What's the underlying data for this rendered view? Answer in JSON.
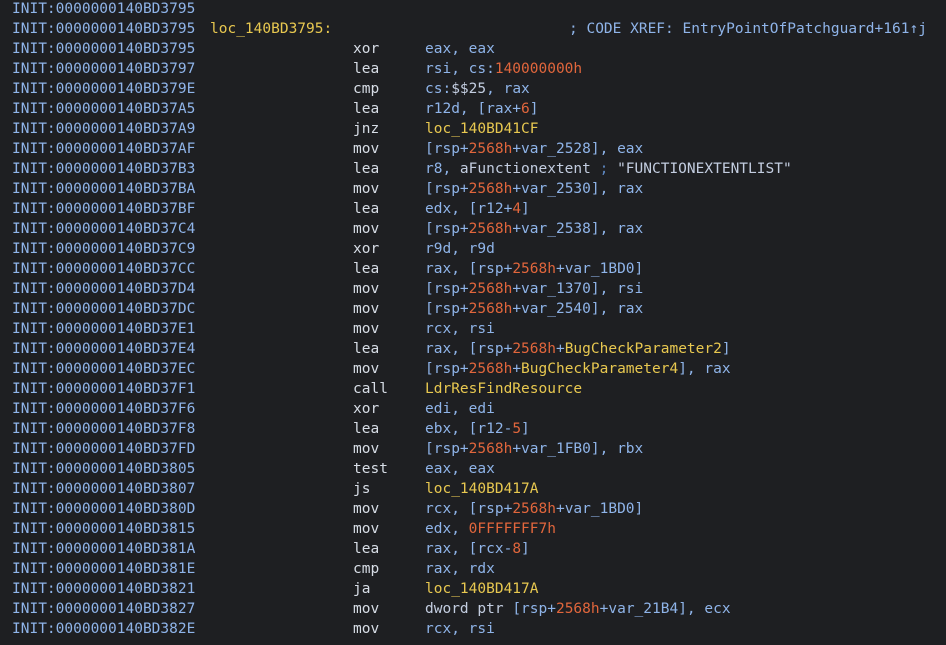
{
  "colors": {
    "background": "#1e1f22",
    "address": "#8fb4e9",
    "mnemonic": "#d7dde6",
    "register": "#8fb4e9",
    "number": "#e1663c",
    "symbol": "#e8c850",
    "string": "#c3cde0",
    "comment": "#5e88c2"
  },
  "listing": {
    "lines": [
      {
        "addr": "INIT:0000000140BD3795",
        "label": "",
        "mnemonic": "",
        "operands": [],
        "xref": ""
      },
      {
        "addr": "INIT:0000000140BD3795",
        "label": "loc_140BD3795:",
        "mnemonic": "",
        "operands": [],
        "xref": "; CODE XREF: EntryPointOfPatchguard+161↑j"
      },
      {
        "addr": "INIT:0000000140BD3795",
        "label": "",
        "mnemonic": "xor",
        "operands": [
          {
            "t": "reg",
            "v": "eax, eax"
          }
        ],
        "xref": ""
      },
      {
        "addr": "INIT:0000000140BD3797",
        "label": "",
        "mnemonic": "lea",
        "operands": [
          {
            "t": "reg",
            "v": "rsi, cs:"
          },
          {
            "t": "num",
            "v": "140000000h"
          }
        ],
        "xref": ""
      },
      {
        "addr": "INIT:0000000140BD379E",
        "label": "",
        "mnemonic": "cmp",
        "operands": [
          {
            "t": "reg",
            "v": "cs:"
          },
          {
            "t": "str",
            "v": "$$25"
          },
          {
            "t": "reg",
            "v": ", rax"
          }
        ],
        "xref": ""
      },
      {
        "addr": "INIT:0000000140BD37A5",
        "label": "",
        "mnemonic": "lea",
        "operands": [
          {
            "t": "reg",
            "v": "r12d, [rax+"
          },
          {
            "t": "num",
            "v": "6"
          },
          {
            "t": "reg",
            "v": "]"
          }
        ],
        "xref": ""
      },
      {
        "addr": "INIT:0000000140BD37A9",
        "label": "",
        "mnemonic": "jnz",
        "operands": [
          {
            "t": "sym",
            "v": "loc_140BD41CF"
          }
        ],
        "xref": ""
      },
      {
        "addr": "INIT:0000000140BD37AF",
        "label": "",
        "mnemonic": "mov",
        "operands": [
          {
            "t": "reg",
            "v": "[rsp+"
          },
          {
            "t": "num",
            "v": "2568h"
          },
          {
            "t": "reg",
            "v": "+"
          },
          {
            "t": "var",
            "v": "var_2528"
          },
          {
            "t": "reg",
            "v": "], eax"
          }
        ],
        "xref": ""
      },
      {
        "addr": "INIT:0000000140BD37B3",
        "label": "",
        "mnemonic": "lea",
        "operands": [
          {
            "t": "reg",
            "v": "r8, "
          },
          {
            "t": "str",
            "v": "aFunctionextent"
          },
          {
            "t": "cmt",
            "v": " ; "
          },
          {
            "t": "str",
            "v": "\"FUNCTIONEXTENTLIST\""
          }
        ],
        "xref": ""
      },
      {
        "addr": "INIT:0000000140BD37BA",
        "label": "",
        "mnemonic": "mov",
        "operands": [
          {
            "t": "reg",
            "v": "[rsp+"
          },
          {
            "t": "num",
            "v": "2568h"
          },
          {
            "t": "reg",
            "v": "+"
          },
          {
            "t": "var",
            "v": "var_2530"
          },
          {
            "t": "reg",
            "v": "], rax"
          }
        ],
        "xref": ""
      },
      {
        "addr": "INIT:0000000140BD37BF",
        "label": "",
        "mnemonic": "lea",
        "operands": [
          {
            "t": "reg",
            "v": "edx, [r12+"
          },
          {
            "t": "num",
            "v": "4"
          },
          {
            "t": "reg",
            "v": "]"
          }
        ],
        "xref": ""
      },
      {
        "addr": "INIT:0000000140BD37C4",
        "label": "",
        "mnemonic": "mov",
        "operands": [
          {
            "t": "reg",
            "v": "[rsp+"
          },
          {
            "t": "num",
            "v": "2568h"
          },
          {
            "t": "reg",
            "v": "+"
          },
          {
            "t": "var",
            "v": "var_2538"
          },
          {
            "t": "reg",
            "v": "], rax"
          }
        ],
        "xref": ""
      },
      {
        "addr": "INIT:0000000140BD37C9",
        "label": "",
        "mnemonic": "xor",
        "operands": [
          {
            "t": "reg",
            "v": "r9d, r9d"
          }
        ],
        "xref": ""
      },
      {
        "addr": "INIT:0000000140BD37CC",
        "label": "",
        "mnemonic": "lea",
        "operands": [
          {
            "t": "reg",
            "v": "rax, [rsp+"
          },
          {
            "t": "num",
            "v": "2568h"
          },
          {
            "t": "reg",
            "v": "+"
          },
          {
            "t": "var",
            "v": "var_1BD0"
          },
          {
            "t": "reg",
            "v": "]"
          }
        ],
        "xref": ""
      },
      {
        "addr": "INIT:0000000140BD37D4",
        "label": "",
        "mnemonic": "mov",
        "operands": [
          {
            "t": "reg",
            "v": "[rsp+"
          },
          {
            "t": "num",
            "v": "2568h"
          },
          {
            "t": "reg",
            "v": "+"
          },
          {
            "t": "var",
            "v": "var_1370"
          },
          {
            "t": "reg",
            "v": "], rsi"
          }
        ],
        "xref": ""
      },
      {
        "addr": "INIT:0000000140BD37DC",
        "label": "",
        "mnemonic": "mov",
        "operands": [
          {
            "t": "reg",
            "v": "[rsp+"
          },
          {
            "t": "num",
            "v": "2568h"
          },
          {
            "t": "reg",
            "v": "+"
          },
          {
            "t": "var",
            "v": "var_2540"
          },
          {
            "t": "reg",
            "v": "], rax"
          }
        ],
        "xref": ""
      },
      {
        "addr": "INIT:0000000140BD37E1",
        "label": "",
        "mnemonic": "mov",
        "operands": [
          {
            "t": "reg",
            "v": "rcx, rsi"
          }
        ],
        "xref": ""
      },
      {
        "addr": "INIT:0000000140BD37E4",
        "label": "",
        "mnemonic": "lea",
        "operands": [
          {
            "t": "reg",
            "v": "rax, [rsp+"
          },
          {
            "t": "num",
            "v": "2568h"
          },
          {
            "t": "reg",
            "v": "+"
          },
          {
            "t": "sym",
            "v": "BugCheckParameter2"
          },
          {
            "t": "reg",
            "v": "]"
          }
        ],
        "xref": ""
      },
      {
        "addr": "INIT:0000000140BD37EC",
        "label": "",
        "mnemonic": "mov",
        "operands": [
          {
            "t": "reg",
            "v": "[rsp+"
          },
          {
            "t": "num",
            "v": "2568h"
          },
          {
            "t": "reg",
            "v": "+"
          },
          {
            "t": "sym",
            "v": "BugCheckParameter4"
          },
          {
            "t": "reg",
            "v": "], rax"
          }
        ],
        "xref": ""
      },
      {
        "addr": "INIT:0000000140BD37F1",
        "label": "",
        "mnemonic": "call",
        "operands": [
          {
            "t": "sym",
            "v": "LdrResFindResource"
          }
        ],
        "xref": ""
      },
      {
        "addr": "INIT:0000000140BD37F6",
        "label": "",
        "mnemonic": "xor",
        "operands": [
          {
            "t": "reg",
            "v": "edi, edi"
          }
        ],
        "xref": ""
      },
      {
        "addr": "INIT:0000000140BD37F8",
        "label": "",
        "mnemonic": "lea",
        "operands": [
          {
            "t": "reg",
            "v": "ebx, [r12-"
          },
          {
            "t": "num",
            "v": "5"
          },
          {
            "t": "reg",
            "v": "]"
          }
        ],
        "xref": ""
      },
      {
        "addr": "INIT:0000000140BD37FD",
        "label": "",
        "mnemonic": "mov",
        "operands": [
          {
            "t": "reg",
            "v": "[rsp+"
          },
          {
            "t": "num",
            "v": "2568h"
          },
          {
            "t": "reg",
            "v": "+"
          },
          {
            "t": "var",
            "v": "var_1FB0"
          },
          {
            "t": "reg",
            "v": "], rbx"
          }
        ],
        "xref": ""
      },
      {
        "addr": "INIT:0000000140BD3805",
        "label": "",
        "mnemonic": "test",
        "operands": [
          {
            "t": "reg",
            "v": "eax, eax"
          }
        ],
        "xref": ""
      },
      {
        "addr": "INIT:0000000140BD3807",
        "label": "",
        "mnemonic": "js",
        "operands": [
          {
            "t": "sym",
            "v": "loc_140BD417A"
          }
        ],
        "xref": ""
      },
      {
        "addr": "INIT:0000000140BD380D",
        "label": "",
        "mnemonic": "mov",
        "operands": [
          {
            "t": "reg",
            "v": "rcx, [rsp+"
          },
          {
            "t": "num",
            "v": "2568h"
          },
          {
            "t": "reg",
            "v": "+"
          },
          {
            "t": "var",
            "v": "var_1BD0"
          },
          {
            "t": "reg",
            "v": "]"
          }
        ],
        "xref": ""
      },
      {
        "addr": "INIT:0000000140BD3815",
        "label": "",
        "mnemonic": "mov",
        "operands": [
          {
            "t": "reg",
            "v": "edx, "
          },
          {
            "t": "num",
            "v": "0FFFFFFF7h"
          }
        ],
        "xref": ""
      },
      {
        "addr": "INIT:0000000140BD381A",
        "label": "",
        "mnemonic": "lea",
        "operands": [
          {
            "t": "reg",
            "v": "rax, [rcx-"
          },
          {
            "t": "num",
            "v": "8"
          },
          {
            "t": "reg",
            "v": "]"
          }
        ],
        "xref": ""
      },
      {
        "addr": "INIT:0000000140BD381E",
        "label": "",
        "mnemonic": "cmp",
        "operands": [
          {
            "t": "reg",
            "v": "rax, rdx"
          }
        ],
        "xref": ""
      },
      {
        "addr": "INIT:0000000140BD3821",
        "label": "",
        "mnemonic": "ja",
        "operands": [
          {
            "t": "sym",
            "v": "loc_140BD417A"
          }
        ],
        "xref": ""
      },
      {
        "addr": "INIT:0000000140BD3827",
        "label": "",
        "mnemonic": "mov",
        "operands": [
          {
            "t": "str",
            "v": "dword ptr "
          },
          {
            "t": "reg",
            "v": "[rsp+"
          },
          {
            "t": "num",
            "v": "2568h"
          },
          {
            "t": "reg",
            "v": "+"
          },
          {
            "t": "var",
            "v": "var_21B4"
          },
          {
            "t": "reg",
            "v": "], ecx"
          }
        ],
        "xref": ""
      },
      {
        "addr": "INIT:0000000140BD382E",
        "label": "",
        "mnemonic": "mov",
        "operands": [
          {
            "t": "reg",
            "v": "rcx, rsi"
          }
        ],
        "xref": ""
      }
    ]
  }
}
